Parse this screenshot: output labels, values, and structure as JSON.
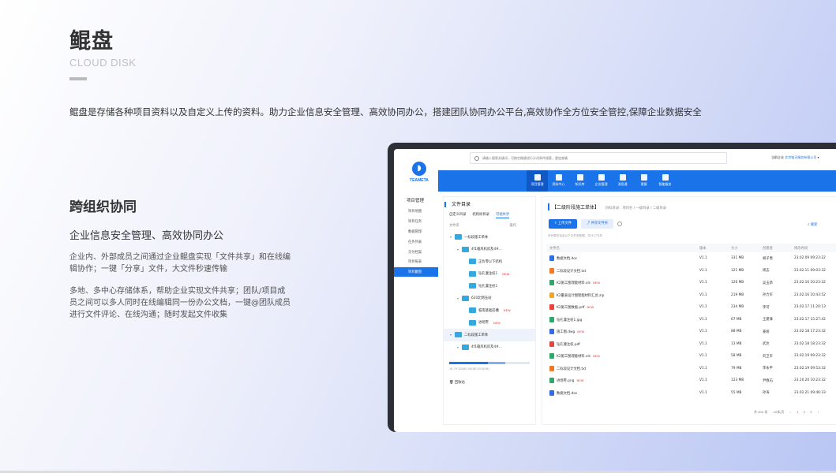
{
  "hero": {
    "title": "鲲盘",
    "subtitle": "CLOUD DISK",
    "description": "鲲盘是存储各种项目资料以及自定义上传的资料。助力企业信息安全管理、高效协同办公，搭建团队协同办公平台,高效协作全方位安全管控,保障企业数据安全"
  },
  "section": {
    "title": "跨组织协同",
    "subtitle": "企业信息安全管理、高效协同办公",
    "para1": "企业内、外部成员之间通过企业鲲盘实现「文件共享」和在线编辑协作；一键「分享」文件，大文件秒速传输",
    "para2": "多地、多中心存储体系，帮助企业实现文件共享；团队/项目成员之间可以多人同时在线编辑同一份办公文档，一键@团队成员进行文件评论、在线沟通；随时发起文件收集"
  },
  "app": {
    "search_placeholder": "请输入搜索关键词，可按空格键进行分词条件搜索，更加准确",
    "company_label": "当前企业",
    "company_name": "北京链天服务有限公司",
    "logo_text": "TEAMETA",
    "nav": [
      "项目管理",
      "资料中心",
      "知识库",
      "企业管理",
      "消息通",
      "便捷",
      "智能服务"
    ],
    "side_head": "项目管理",
    "side_items": [
      "项目地图",
      "项目任务",
      "数据管理",
      "任务列表",
      "交付档案",
      "项目报表",
      "项目鲲盘"
    ],
    "tree": {
      "title": "文件目录",
      "tabs": [
        "自定义目录",
        "结构树目录",
        "可视共享"
      ],
      "col_folder": "文件夹",
      "col_op": "操作",
      "nodes": [
        {
          "label": "一标段施工单体",
          "indent": 0
        },
        {
          "label": "4f1箱风机房及4#...",
          "indent": 1
        },
        {
          "label": "正负零以下结构",
          "indent": 2
        },
        {
          "label": "钻孔灌注桩1",
          "indent": 2,
          "new": "NEW"
        },
        {
          "label": "钻孔灌注桩1",
          "indent": 2
        },
        {
          "label": "620北侧压站",
          "indent": 1
        },
        {
          "label": "临南基础前槽",
          "indent": 2,
          "new": "NEW"
        },
        {
          "label": "进场警",
          "indent": 2,
          "new": "NEW"
        },
        {
          "label": "二标段施工单体",
          "indent": 0,
          "sel": true
        },
        {
          "label": "4f1箱风机房及4#...",
          "indent": 1
        }
      ],
      "storage": "16.79 GB/80.00GB(1000GB)",
      "recycle": "回收站"
    },
    "files": {
      "title": "【二级阶段施工单体】",
      "crumb": "目标目录：项目名 / 一级目录 / 二级目录",
      "upload": "上传文件",
      "share": "共享文件夹",
      "search": "搜索",
      "note": "本列表仅包含以下文件夹数据，共计17文件",
      "headers": [
        "文件名",
        "版本",
        "大小",
        "创建者",
        "修改时间"
      ],
      "rows": [
        {
          "name": "数据文档.doc",
          "ver": "V1.1",
          "size": "331 MB",
          "user": "胡子羡",
          "time": "23.02.09 09:23:22",
          "color": "#2f6fe0"
        },
        {
          "name": "二标段设计文档.txt",
          "ver": "V1.1",
          "size": "121 MB",
          "user": "周志",
          "time": "23.02.11 09:03:32",
          "color": "#f07a2a"
        },
        {
          "name": "K2施工图理能材料.xls",
          "ver": "V1.1",
          "size": "126 MB",
          "user": "吴玉新",
          "time": "23.02.16 10:23:32",
          "color": "#2fa86a",
          "new": "NEW"
        },
        {
          "name": "K2量表设计图理能材料汇总.zip",
          "ver": "V1.1",
          "size": "219 MB",
          "user": "孙力军",
          "time": "23.02.16 10:43:52",
          "color": "#f0a52a"
        },
        {
          "name": "K2施工图数据.pdf",
          "ver": "V1.1",
          "size": "234 MB",
          "user": "李可",
          "time": "23.02.17 11:20:13",
          "color": "#e6453b",
          "new": "NEW"
        },
        {
          "name": "钻孔灌注桩1.jpg",
          "ver": "V1.1",
          "size": "67 MB",
          "user": "王建锋",
          "time": "23.02.17 15:27:42",
          "color": "#2fa86a"
        },
        {
          "name": "施工图.dwg",
          "ver": "V1.1",
          "size": "88 MB",
          "user": "姜娅",
          "time": "23.02.18 17:23:32",
          "color": "#2f6fe0",
          "new": "NEW"
        },
        {
          "name": "钻孔灌注桩.pdf",
          "ver": "V1.1",
          "size": "13 MB",
          "user": "武达",
          "time": "23.02.18 18:23:32",
          "color": "#e6453b"
        },
        {
          "name": "K2施工图理能材料.xls",
          "ver": "V1.1",
          "size": "58 MB",
          "user": "刘卫军",
          "time": "23.02.19 09:23:32",
          "color": "#2fa86a",
          "new": "NEW"
        },
        {
          "name": "二标段设计文档.txt",
          "ver": "V1.1",
          "size": "79 MB",
          "user": "李永平",
          "time": "23.02.19 09:53:32",
          "color": "#f07a2a"
        },
        {
          "name": "进场警.png",
          "ver": "V1.1",
          "size": "123 MB",
          "user": "尹春石",
          "time": "23.10.20 10:23:32",
          "color": "#2fa86a",
          "new": "NEW"
        },
        {
          "name": "数据文档.doc",
          "ver": "V1.1",
          "size": "55 MB",
          "user": "孙涛",
          "time": "23.02.21 09:46:33",
          "color": "#2f6fe0"
        }
      ],
      "pager_total": "共 400 条",
      "pager_size": "20条/页",
      "pages": [
        "1",
        "2",
        "3"
      ]
    }
  }
}
